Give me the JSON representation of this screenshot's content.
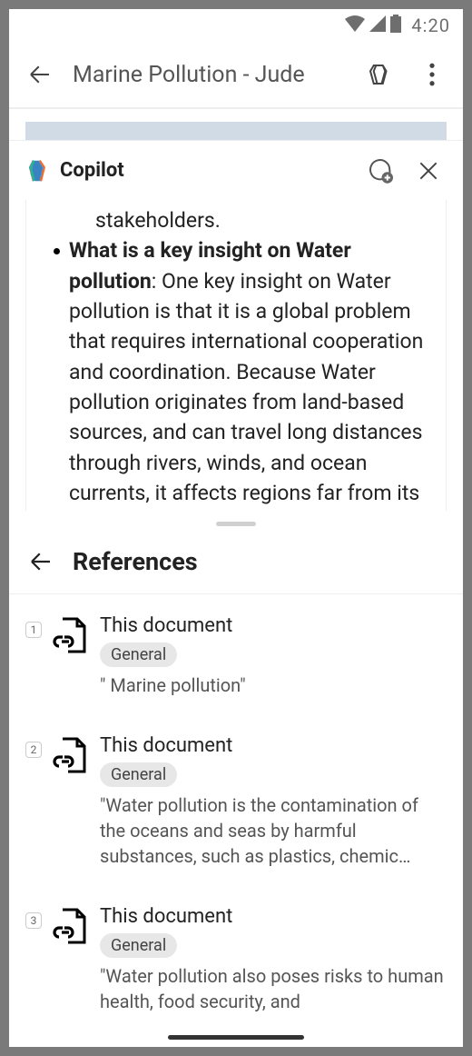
{
  "status": {
    "time": "4:20"
  },
  "appbar": {
    "title": "Marine Pollution - Jude"
  },
  "copilot": {
    "title": "Copilot",
    "response": {
      "line_prev": "stakeholders.",
      "bold_prefix": "What is a key insight on Water pollution",
      "body": ": One key insight on Water pollution is that it is a global problem that requires international cooperation and coordination. Because Water pollution originates from land-based sources, and can travel long distances through rivers, winds, and ocean currents, it affects regions far from its"
    }
  },
  "references": {
    "title": "References",
    "items": [
      {
        "num": "1",
        "source": "This document",
        "badge": "General",
        "snippet": "\" Marine pollution\""
      },
      {
        "num": "2",
        "source": "This document",
        "badge": "General",
        "snippet": "\"Water pollution is the contamination of the oceans and seas by harmful substances, such as plastics, chemic…"
      },
      {
        "num": "3",
        "source": "This document",
        "badge": "General",
        "snippet": "\"Water pollution also poses risks to human health, food security, and"
      }
    ]
  }
}
